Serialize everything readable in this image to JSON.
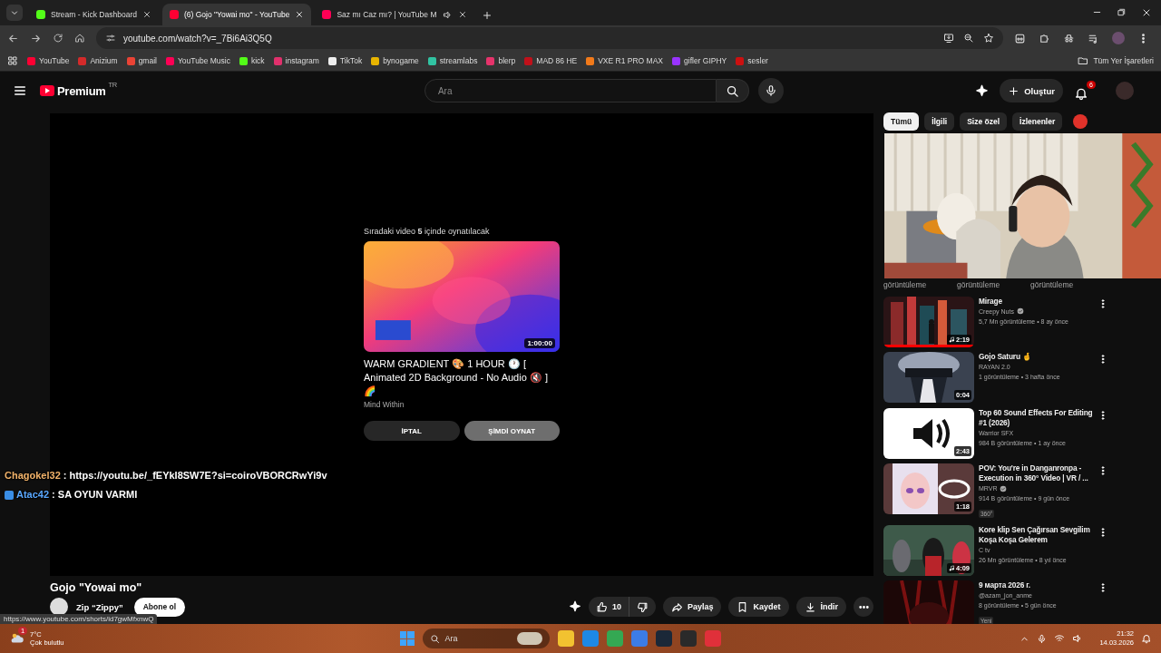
{
  "browser": {
    "tabs": [
      {
        "title": "Stream - Kick Dashboard",
        "selected": false,
        "audible": false,
        "color": "#53fc18"
      },
      {
        "title": "(6) Gojo \"Yowai mo\" - YouTube",
        "selected": true,
        "audible": false,
        "color": "#ff0033"
      },
      {
        "title": "Saz mı Caz mı? | YouTube M",
        "selected": false,
        "audible": true,
        "color": "#ff0055"
      }
    ],
    "address": "youtube.com/watch?v=_7Bi6Ai3Q5Q",
    "bookmarks": [
      {
        "label": "YouTube",
        "color": "#ff0033"
      },
      {
        "label": "Anizium",
        "color": "#d42a2a"
      },
      {
        "label": "gmail",
        "color": "#ea4335"
      },
      {
        "label": "YouTube Music",
        "color": "#ff0055"
      },
      {
        "label": "kick",
        "color": "#53fc18"
      },
      {
        "label": "instagram",
        "color": "#e1306c"
      },
      {
        "label": "TikTok",
        "color": "#eeeeee"
      },
      {
        "label": "bynogame",
        "color": "#e8b400"
      },
      {
        "label": "streamlabs",
        "color": "#31c3a2"
      },
      {
        "label": "blerp",
        "color": "#e6336b"
      },
      {
        "label": "MAD 86 HE",
        "color": "#c0101a"
      },
      {
        "label": "VXE R1 PRO MAX",
        "color": "#f27a1a"
      },
      {
        "label": "gifler GIPHY",
        "color": "#9933ff"
      },
      {
        "label": "sesler",
        "color": "#cc1010"
      }
    ],
    "all_bookmarks": "Tüm Yer İşaretleri"
  },
  "header": {
    "logo": "Premium",
    "region": "TR",
    "search_placeholder": "Ara",
    "create": "Oluştur",
    "notifications": "6"
  },
  "player": {
    "up_next": "Sıradaki video **5** içinde oynatılacak",
    "duration": "1:00:00",
    "title": "WARM GRADIENT 🎨 1 HOUR 🕐 [ Animated 2D Background - No Audio 🔇 ] 🌈",
    "channel": "Mind Within",
    "cancel": "İPTAL",
    "play_now": "ŞİMDİ OYNAT"
  },
  "chat": [
    {
      "user": "Chagokel32",
      "color": "#f2b36a",
      "message": ": https://youtu.be/_fEYkI8SW7E?si=coiroVBORCRwYi9v"
    },
    {
      "user": "Atac42",
      "color": "#5aa8ff",
      "message": ": SA OYUN VARMI"
    }
  ],
  "video": {
    "title": "Gojo \"Yowai mo\"",
    "channel": "Zip “Zippy”",
    "subscribe": "Abone ol",
    "likes": "10",
    "share": "Paylaş",
    "save": "Kaydet",
    "download": "İndir"
  },
  "status_url": "https://www.youtube.com/shorts/id7gwMfxnwQ",
  "sidebar": {
    "chips": [
      {
        "label": "Tümü",
        "selected": true
      },
      {
        "label": "İlgili",
        "selected": false
      },
      {
        "label": "Size özel",
        "selected": false
      },
      {
        "label": "İzlenenler",
        "selected": false
      }
    ],
    "shelf_views": [
      "görüntüleme",
      "görüntüleme",
      "görüntüleme"
    ],
    "items": [
      {
        "title": "Mirage",
        "channel": "Creepy Nuts",
        "verified": true,
        "meta": "5,7 Mn görüntüleme • 8 ay önce",
        "duration": "2:19",
        "music": true,
        "level": 1
      },
      {
        "title": "Gojo Saturu 🤞",
        "channel": "RAYAN 2.0",
        "verified": false,
        "meta": "1 görüntüleme • 3 hafta önce",
        "duration": "0:04",
        "music": false
      },
      {
        "title": "Top 60 Sound Effects For Editing #1 (2026)",
        "channel": "Warrior SFX",
        "verified": false,
        "meta": "984 B görüntüleme • 1 ay önce",
        "duration": "2:43",
        "music": false
      },
      {
        "title": "POV: You're in Danganronpa - Execution in 360° Video | VR / ...",
        "channel": "MRVR",
        "verified": true,
        "meta": "914 B görüntüleme • 9 gün önce",
        "duration": "1:18",
        "music": false,
        "badge": "360°"
      },
      {
        "title": "Kore klip Sen Çağırsan Sevgilim Koşa Koşa Gelerem",
        "channel": "C tv",
        "verified": false,
        "meta": "26 Mn görüntüleme • 8 yıl önce",
        "duration": "4:09",
        "music": true
      },
      {
        "title": "9 марта 2026 г.",
        "channel": "@azam_jon_anme",
        "verified": false,
        "meta": "8 görüntüleme • 5 gün önce",
        "music": false,
        "badge": "Yeni"
      }
    ]
  },
  "taskbar": {
    "temperature": "7°C",
    "weather": "Çok bulutlu",
    "weather_badge": "1",
    "search_placeholder": "Ara",
    "time": "21:32",
    "date": "14.03.2026"
  }
}
